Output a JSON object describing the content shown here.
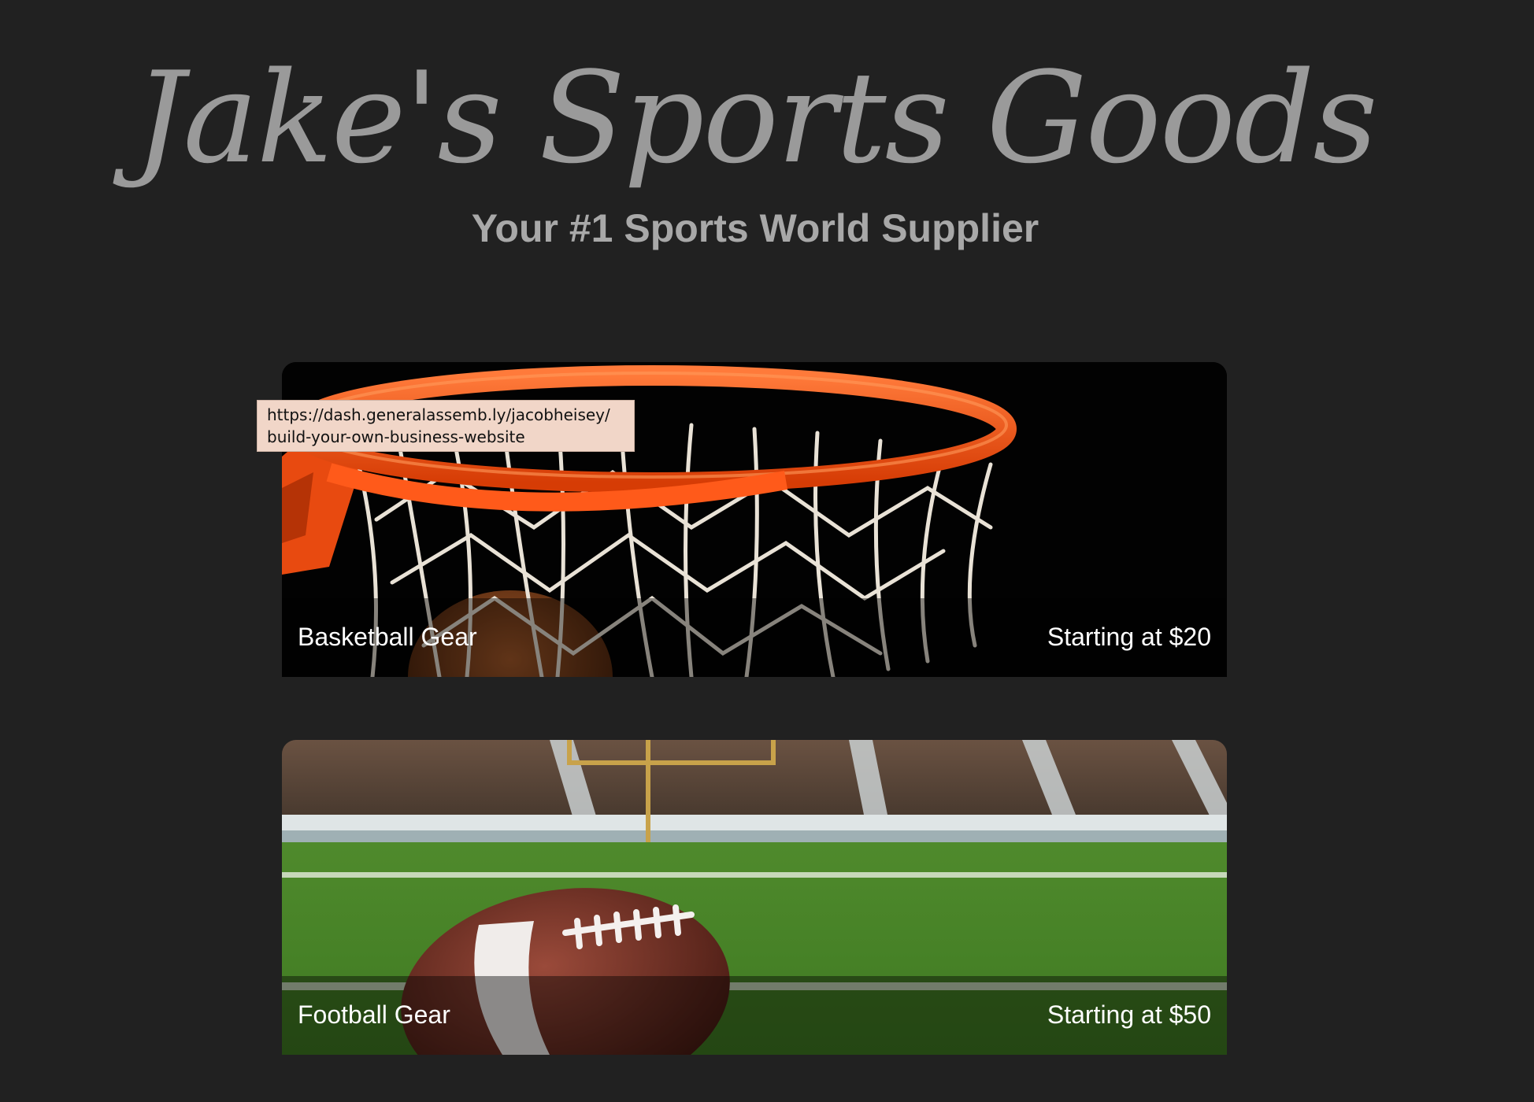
{
  "header": {
    "title": "Jake's Sports Goods",
    "tagline": "Your #1 Sports World Supplier"
  },
  "cards": [
    {
      "name": "Basketball Gear",
      "price": "Starting at $20",
      "image": "basketball-hoop-photo"
    },
    {
      "name": "Football Gear",
      "price": "Starting at $50",
      "image": "football-field-photo"
    }
  ],
  "tooltip": {
    "line1": "https://dash.generalassemb.ly/jacobheisey/",
    "line2": "build-your-own-business-website"
  },
  "colors": {
    "background": "#212121",
    "title": "#9a9a9a",
    "tagline": "#a8a8a8",
    "rim": "#ff5a1a",
    "turf": "#4f8a2c",
    "tooltip_bg": "#f1d6c8"
  }
}
